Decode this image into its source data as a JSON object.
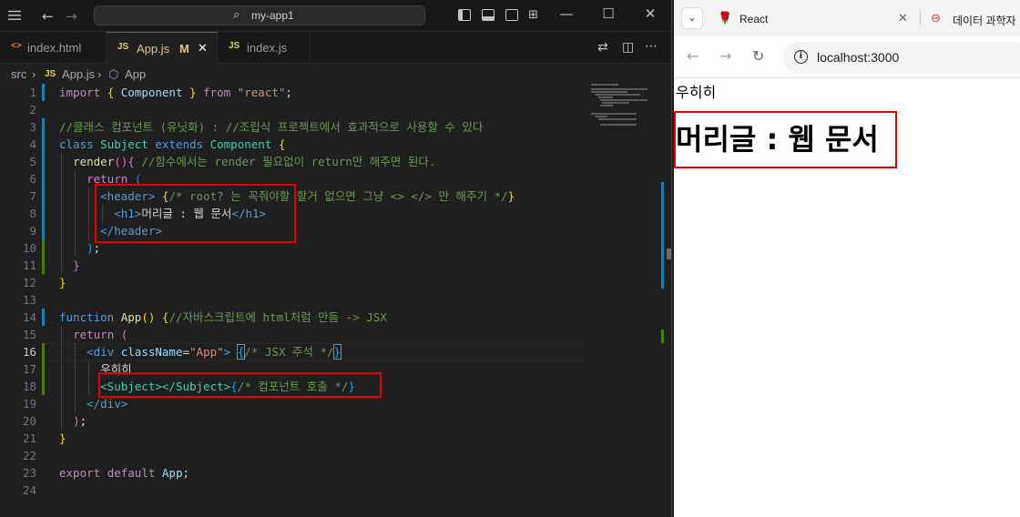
{
  "vscode": {
    "title": "my-app1",
    "tabs": [
      {
        "label": "index.html",
        "icon": "<>",
        "active": false
      },
      {
        "label": "App.js",
        "icon": "JS",
        "modified": "M",
        "active": true
      },
      {
        "label": "index.js",
        "icon": "JS",
        "active": false
      }
    ],
    "breadcrumb": {
      "folder": "src",
      "file": "App.js",
      "symbol": "App"
    },
    "line_numbers": [
      "1",
      "2",
      "3",
      "4",
      "5",
      "6",
      "7",
      "8",
      "9",
      "10",
      "11",
      "12",
      "13",
      "14",
      "15",
      "16",
      "17",
      "18",
      "19",
      "20",
      "21",
      "22",
      "23",
      "24"
    ],
    "code": {
      "l1_import": "import",
      "l1_brace_open": "{",
      "l1_component": "Component",
      "l1_brace_close": "}",
      "l1_from": "from",
      "l1_str": "\"react\"",
      "l1_semi": ";",
      "l3_comment": "//클래스 컴포넌트 (유닛화) : //조립식 프로젝트에서 효과적으로 사용할 수 있다",
      "l4_class": "class",
      "l4_name": "Subject",
      "l4_extends": "extends",
      "l4_component": "Component",
      "l4_brace": "{",
      "l5_render": "render",
      "l5_parens": "()",
      "l5_brace": "{",
      "l5_comment": "//함수에서는 render 필요없이 return만 해주면 된다.",
      "l6_return": "return",
      "l6_paren": "(",
      "l7_tag": "<header>",
      "l7_brace_open": "{",
      "l7_comment": "/* root? 는 꼭줘야할 할거 없으면 그냥 <> </> 만 해주기 */",
      "l7_brace_close": "}",
      "l8_open": "<h1>",
      "l8_text": "머리글 : 웹 문서",
      "l8_close": "</h1>",
      "l9_tag": "</header>",
      "l10_paren": ")",
      "l10_semi": ";",
      "l11_brace": "}",
      "l12_brace": "}",
      "l14_function": "function",
      "l14_name": "App",
      "l14_parens": "()",
      "l14_brace": "{",
      "l14_comment": "//자바스크립트에 html처럼 만듬 -> JSX",
      "l15_return": "return",
      "l15_paren": "(",
      "l16_div": "<div",
      "l16_attr": "className",
      "l16_eq": "=",
      "l16_val": "\"App\"",
      "l16_gt": ">",
      "l16_brace_open": "{",
      "l16_comment": "/* JSX 주석 */",
      "l16_brace_close": "}",
      "l17_text": "우히히",
      "l18_tag": "<Subject></Subject>",
      "l18_brace_open": "{",
      "l18_comment": "/* 컴포넌트 호출 */",
      "l18_brace_close": "}",
      "l19_tag": "</div>",
      "l20_paren": ")",
      "l20_semi": ";",
      "l21_brace": "}",
      "l23_export": "export",
      "l23_default": "default",
      "l23_app": "App",
      "l23_semi": ";"
    }
  },
  "browser": {
    "tabs": [
      {
        "label": "React",
        "icon": "rose-favicon"
      },
      {
        "label": "데이터 과학자",
        "icon": "red-circle-favicon"
      }
    ],
    "url": "localhost:3000",
    "page": {
      "text": "우히히",
      "heading": "머리글 : 웹 문서"
    }
  },
  "colors": {
    "editor_bg": "#1f1f1f",
    "highlight_box": "#e60000",
    "active_tab_border": "#0078d4"
  }
}
